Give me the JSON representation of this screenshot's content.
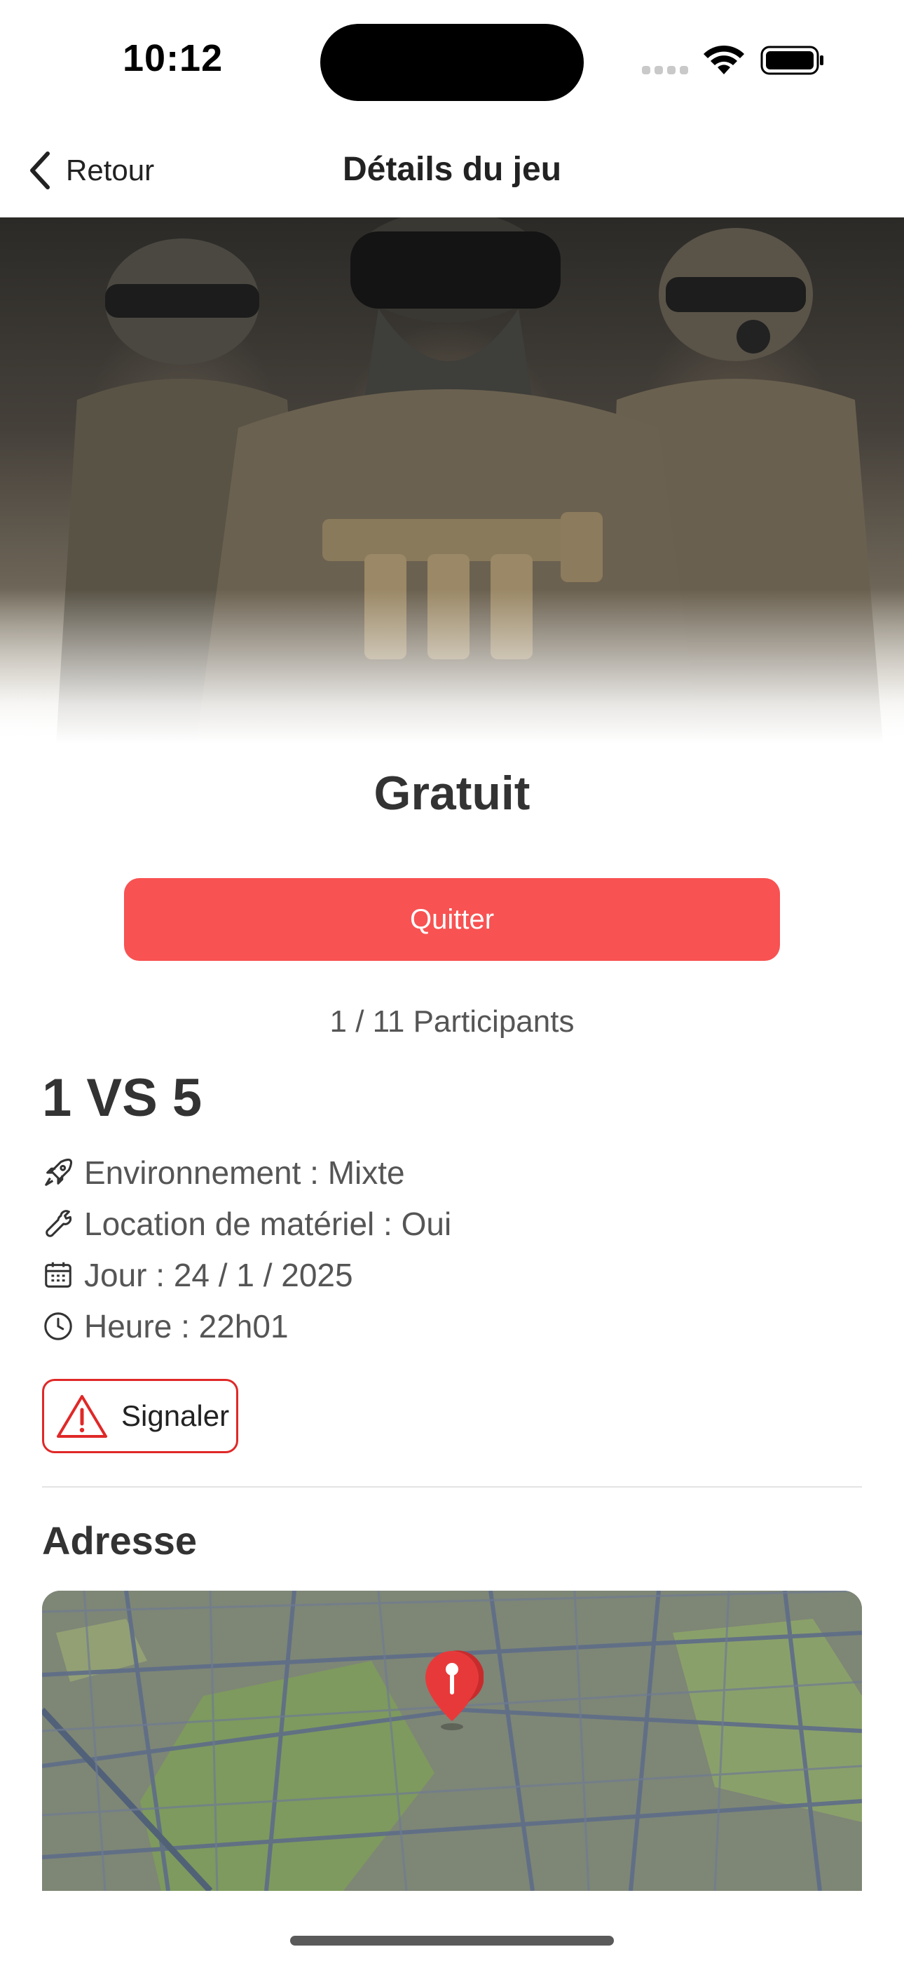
{
  "status_bar": {
    "time": "10:12",
    "icons": [
      "cellular-icon",
      "wifi-icon",
      "battery-icon"
    ]
  },
  "nav": {
    "back_label": "Retour",
    "title": "Détails du jeu",
    "back_icon": "chevron-left-icon"
  },
  "game": {
    "price": "Gratuit",
    "action_button": "Quitter",
    "participants": "1 / 11 Participants",
    "title": "1 VS 5",
    "details": [
      {
        "icon": "rocket-icon",
        "text": "Environnement : Mixte"
      },
      {
        "icon": "wrench-icon",
        "text": "Location de matériel : Oui"
      },
      {
        "icon": "calendar-icon",
        "text": "Jour : 24 / 1 / 2025"
      },
      {
        "icon": "clock-icon",
        "text": "Heure : 22h01"
      }
    ],
    "report_label": "Signaler"
  },
  "address": {
    "title": "Adresse"
  },
  "colors": {
    "accent_red": "#f85252",
    "report_red": "#e02828",
    "text_dark": "#333333",
    "text_muted": "#555555"
  }
}
